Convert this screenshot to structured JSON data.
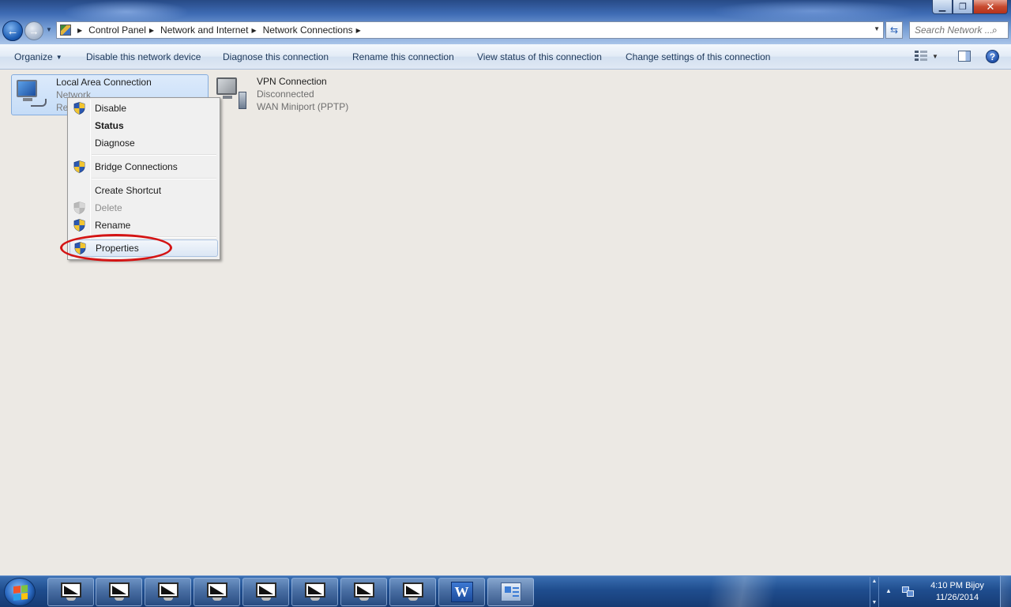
{
  "window": {
    "minimize_glyph": "▁",
    "maximize_glyph": "❐",
    "close_glyph": "✕"
  },
  "address": {
    "breadcrumbs": [
      "Control Panel",
      "Network and Internet",
      "Network Connections"
    ],
    "search_placeholder": "Search Network ..."
  },
  "toolbar": {
    "organize": "Organize",
    "disable_device": "Disable this network device",
    "diagnose": "Diagnose this connection",
    "rename": "Rename this connection",
    "view_status": "View status of this connection",
    "change_settings": "Change settings of this connection",
    "help_glyph": "?"
  },
  "connections": [
    {
      "title": "Local Area Connection",
      "line2": "Network",
      "line3": "Re"
    },
    {
      "title": "VPN Connection",
      "line2": "Disconnected",
      "line3": "WAN Miniport (PPTP)"
    }
  ],
  "context_menu": {
    "items": [
      {
        "label": "Disable",
        "shield": true
      },
      {
        "label": "Status",
        "bold": true
      },
      {
        "label": "Diagnose"
      },
      {
        "label": "Bridge Connections",
        "shield": true
      },
      {
        "label": "Create Shortcut"
      },
      {
        "label": "Delete",
        "shield": true,
        "disabled": true
      },
      {
        "label": "Rename",
        "shield": true
      },
      {
        "label": "Properties",
        "shield": true,
        "highlighted": true
      }
    ]
  },
  "taskbar": {
    "word_label": "W",
    "clock_time": "4:10 PM Bijoy",
    "clock_date": "11/26/2014"
  },
  "colors": {
    "annotation_ring": "#d41414",
    "taskbar": "#1f4d8e",
    "content_background": "#ece9e4"
  }
}
